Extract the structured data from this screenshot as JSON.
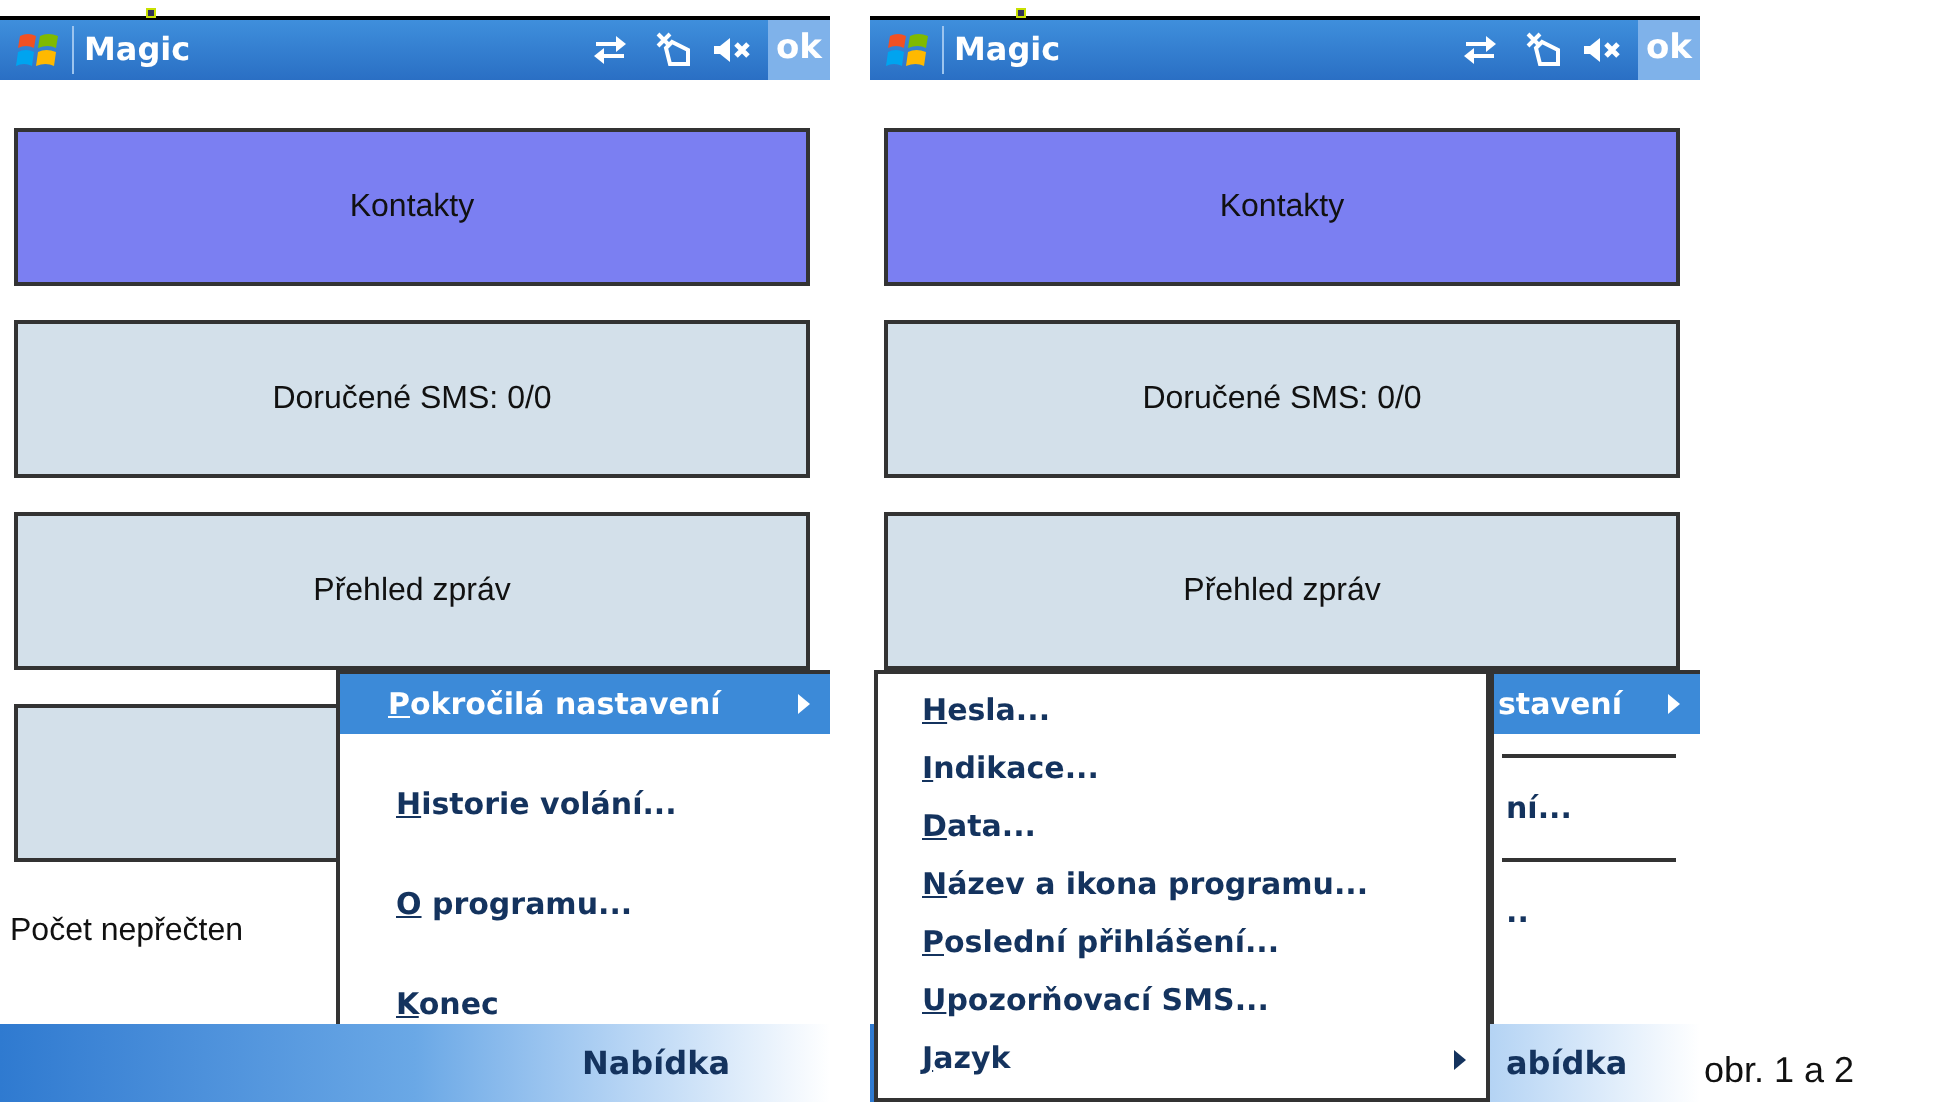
{
  "screens": [
    {
      "title": "Magic",
      "ok": "ok",
      "buttons": [
        {
          "label": "Kontakty",
          "selected": true
        },
        {
          "label": "Doručené SMS: 0/0",
          "selected": false
        },
        {
          "label": "Přehled zpráv",
          "selected": false
        },
        {
          "selected": false
        }
      ],
      "status_text": "Počet nepřečten",
      "menu": {
        "items": [
          {
            "label": "Pokročilá nastavení",
            "selected": true,
            "has_submenu": true,
            "accelerator_shown": true
          },
          {
            "label": "Historie volání...",
            "selected": false,
            "has_submenu": false,
            "accelerator_shown": true
          },
          {
            "label": "O programu...",
            "selected": false,
            "has_submenu": false,
            "accelerator_shown": true
          },
          {
            "label": "Konec",
            "selected": false,
            "has_submenu": false,
            "accelerator_shown": true
          }
        ]
      },
      "softkey": "Nabídka"
    },
    {
      "title": "Magic",
      "ok": "ok",
      "buttons": [
        {
          "label": "Kontakty",
          "selected": true
        },
        {
          "label": "Doručené SMS: 0/0",
          "selected": false
        },
        {
          "label": "Přehled zpráv",
          "selected": false
        }
      ],
      "menu": {
        "partial": true,
        "items": [
          {
            "label": "stavení",
            "selected": true,
            "has_submenu": true,
            "accelerator_shown": false
          },
          {
            "label": "ní...",
            "selected": false,
            "has_submenu": false,
            "accelerator_shown": false
          },
          {
            "label": "..",
            "selected": false,
            "has_submenu": false,
            "accelerator_shown": false
          }
        ]
      },
      "submenu": {
        "items": [
          {
            "label": "Hesla...",
            "has_submenu": false
          },
          {
            "label": "Indikace...",
            "has_submenu": false
          },
          {
            "label": "Data...",
            "has_submenu": false
          },
          {
            "label": "Název a ikona programu...",
            "has_submenu": false
          },
          {
            "label": "Poslední přihlášení...",
            "has_submenu": false
          },
          {
            "label": "Upozorňovací SMS...",
            "has_submenu": false
          },
          {
            "label": "Jazyk",
            "has_submenu": true
          }
        ]
      },
      "softkey": "abídka"
    }
  ],
  "caption": "obr. 1 a 2"
}
